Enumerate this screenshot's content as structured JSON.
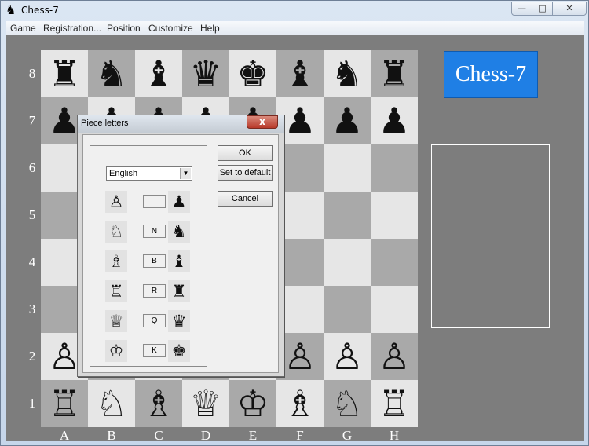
{
  "window": {
    "title": "Chess-7",
    "app_icon": "♞",
    "min_glyph": "—",
    "max_glyph": "□",
    "close_glyph": "✕"
  },
  "menu": [
    "Game",
    "Registration...",
    "Position",
    "Customize",
    "Help"
  ],
  "board": {
    "ranks": [
      "8",
      "7",
      "6",
      "5",
      "4",
      "3",
      "2",
      "1"
    ],
    "files": [
      "A",
      "B",
      "C",
      "D",
      "E",
      "F",
      "G",
      "H"
    ],
    "rows": [
      [
        "♜",
        "♞",
        "♝",
        "♛",
        "♚",
        "♝",
        "♞",
        "♜"
      ],
      [
        "♟",
        "♟",
        "♟",
        "♟",
        "♟",
        "♟",
        "♟",
        "♟"
      ],
      [
        "",
        "",
        "",
        "",
        "",
        "",
        "",
        ""
      ],
      [
        "",
        "",
        "",
        "",
        "",
        "",
        "",
        ""
      ],
      [
        "",
        "",
        "",
        "",
        "",
        "",
        "",
        ""
      ],
      [
        "",
        "",
        "",
        "",
        "",
        "",
        "",
        ""
      ],
      [
        "♙",
        "♙",
        "♙",
        "♙",
        "♙",
        "♙",
        "♙",
        "♙"
      ],
      [
        "♖",
        "♘",
        "♗",
        "♕",
        "♔",
        "♗",
        "♘",
        "♖"
      ]
    ]
  },
  "logo": "Chess-7",
  "dialog": {
    "title": "Piece letters",
    "close_glyph": "x",
    "language": "English",
    "language_arrow": "▼",
    "pieces": [
      {
        "white": "♙",
        "letter": "",
        "black": "♟"
      },
      {
        "white": "♘",
        "letter": "N",
        "black": "♞"
      },
      {
        "white": "♗",
        "letter": "B",
        "black": "♝"
      },
      {
        "white": "♖",
        "letter": "R",
        "black": "♜"
      },
      {
        "white": "♕",
        "letter": "Q",
        "black": "♛"
      },
      {
        "white": "♔",
        "letter": "K",
        "black": "♚"
      }
    ],
    "buttons": {
      "ok": "OK",
      "default": "Set to default",
      "cancel": "Cancel"
    }
  }
}
